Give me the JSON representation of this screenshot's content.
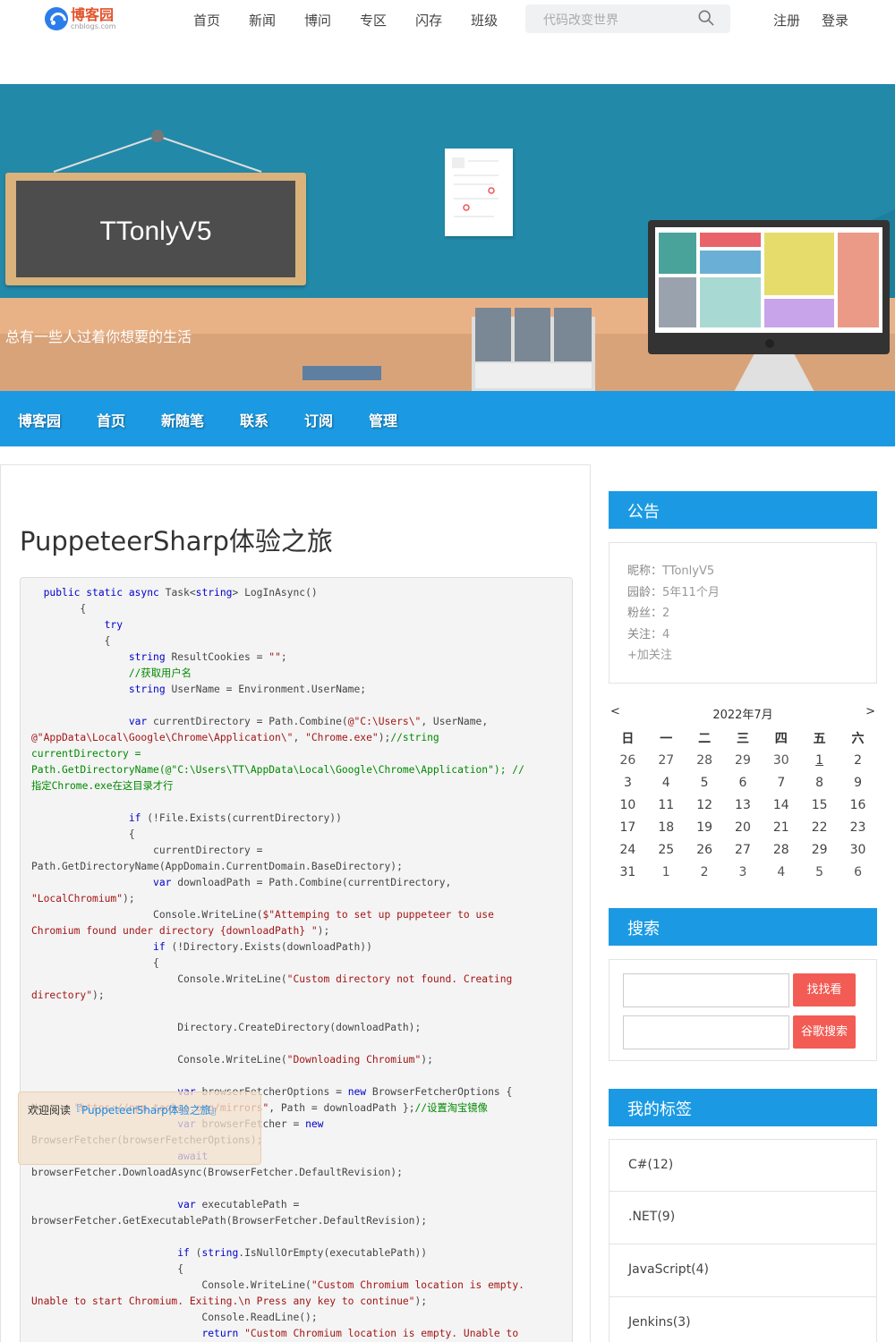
{
  "topbar": {
    "logo_cn": "博客园",
    "logo_en": "cnblogs.com",
    "nav": [
      "首页",
      "新闻",
      "博问",
      "专区",
      "闪存",
      "班级"
    ],
    "search_placeholder": "代码改变世界",
    "register": "注册",
    "login": "登录"
  },
  "banner": {
    "blog_title": "TTonlyV5",
    "subtitle": "总有一些人过着你想要的生活"
  },
  "mainnav": [
    "博客园",
    "首页",
    "新随笔",
    "联系",
    "订阅",
    "管理"
  ],
  "post": {
    "title": "PuppeteerSharp体验之旅"
  },
  "floating_notice": {
    "prefix": "欢迎阅读",
    "link": "『PuppeteerSharp体验之旅』"
  },
  "sidebar": {
    "notice_title": "公告",
    "profile": {
      "nickname_label": "昵称：",
      "nickname": "TTonlyV5",
      "age_label": "园龄：",
      "age": "5年11个月",
      "fans_label": "粉丝：",
      "fans": "2",
      "follow_label": "关注：",
      "follow": "4",
      "add_follow": "+加关注"
    },
    "calendar": {
      "prev": "<",
      "next": ">",
      "month": "2022年7月",
      "weekdays": [
        "日",
        "一",
        "二",
        "三",
        "四",
        "五",
        "六"
      ],
      "weeks": [
        [
          "26",
          "27",
          "28",
          "29",
          "30",
          "1",
          "2"
        ],
        [
          "3",
          "4",
          "5",
          "6",
          "7",
          "8",
          "9"
        ],
        [
          "10",
          "11",
          "12",
          "13",
          "14",
          "15",
          "16"
        ],
        [
          "17",
          "18",
          "19",
          "20",
          "21",
          "22",
          "23"
        ],
        [
          "24",
          "25",
          "26",
          "27",
          "28",
          "29",
          "30"
        ],
        [
          "31",
          "1",
          "2",
          "3",
          "4",
          "5",
          "6"
        ]
      ]
    },
    "search_title": "搜索",
    "search_button": "找找看",
    "google_button": "谷歌搜索",
    "tags_title": "我的标签",
    "tags": [
      "C#(12)",
      ".NET(9)",
      "JavaScript(4)",
      "Jenkins(3)"
    ]
  }
}
